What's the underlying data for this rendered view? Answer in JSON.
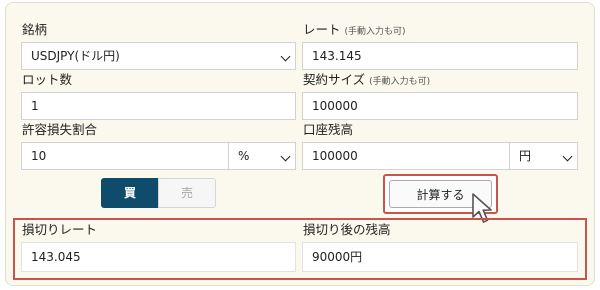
{
  "left": {
    "pair_label": "銘柄",
    "pair_value": "USDJPY(ドル円)",
    "lot_label": "ロット数",
    "lot_value": "1",
    "loss_label": "許容損失割合",
    "loss_value": "10",
    "loss_unit": "%"
  },
  "right": {
    "rate_label": "レート",
    "rate_note": "(手動入力も可)",
    "rate_value": "143.145",
    "contract_label": "契約サイズ",
    "contract_note": "(手動入力も可)",
    "contract_value": "100000",
    "balance_label": "口座残高",
    "balance_value": "100000",
    "balance_unit": "円"
  },
  "actions": {
    "buy_label": "買",
    "sell_label": "売",
    "calc_label": "計算する"
  },
  "results": {
    "stop_rate_label": "損切りレート",
    "stop_rate_value": "143.045",
    "balance_after_label": "損切り後の残高",
    "balance_after_value": "90000円"
  },
  "colors": {
    "accent": "#0f4c6b",
    "highlight": "#c85450",
    "panel_bg": "#fbf9ee"
  }
}
